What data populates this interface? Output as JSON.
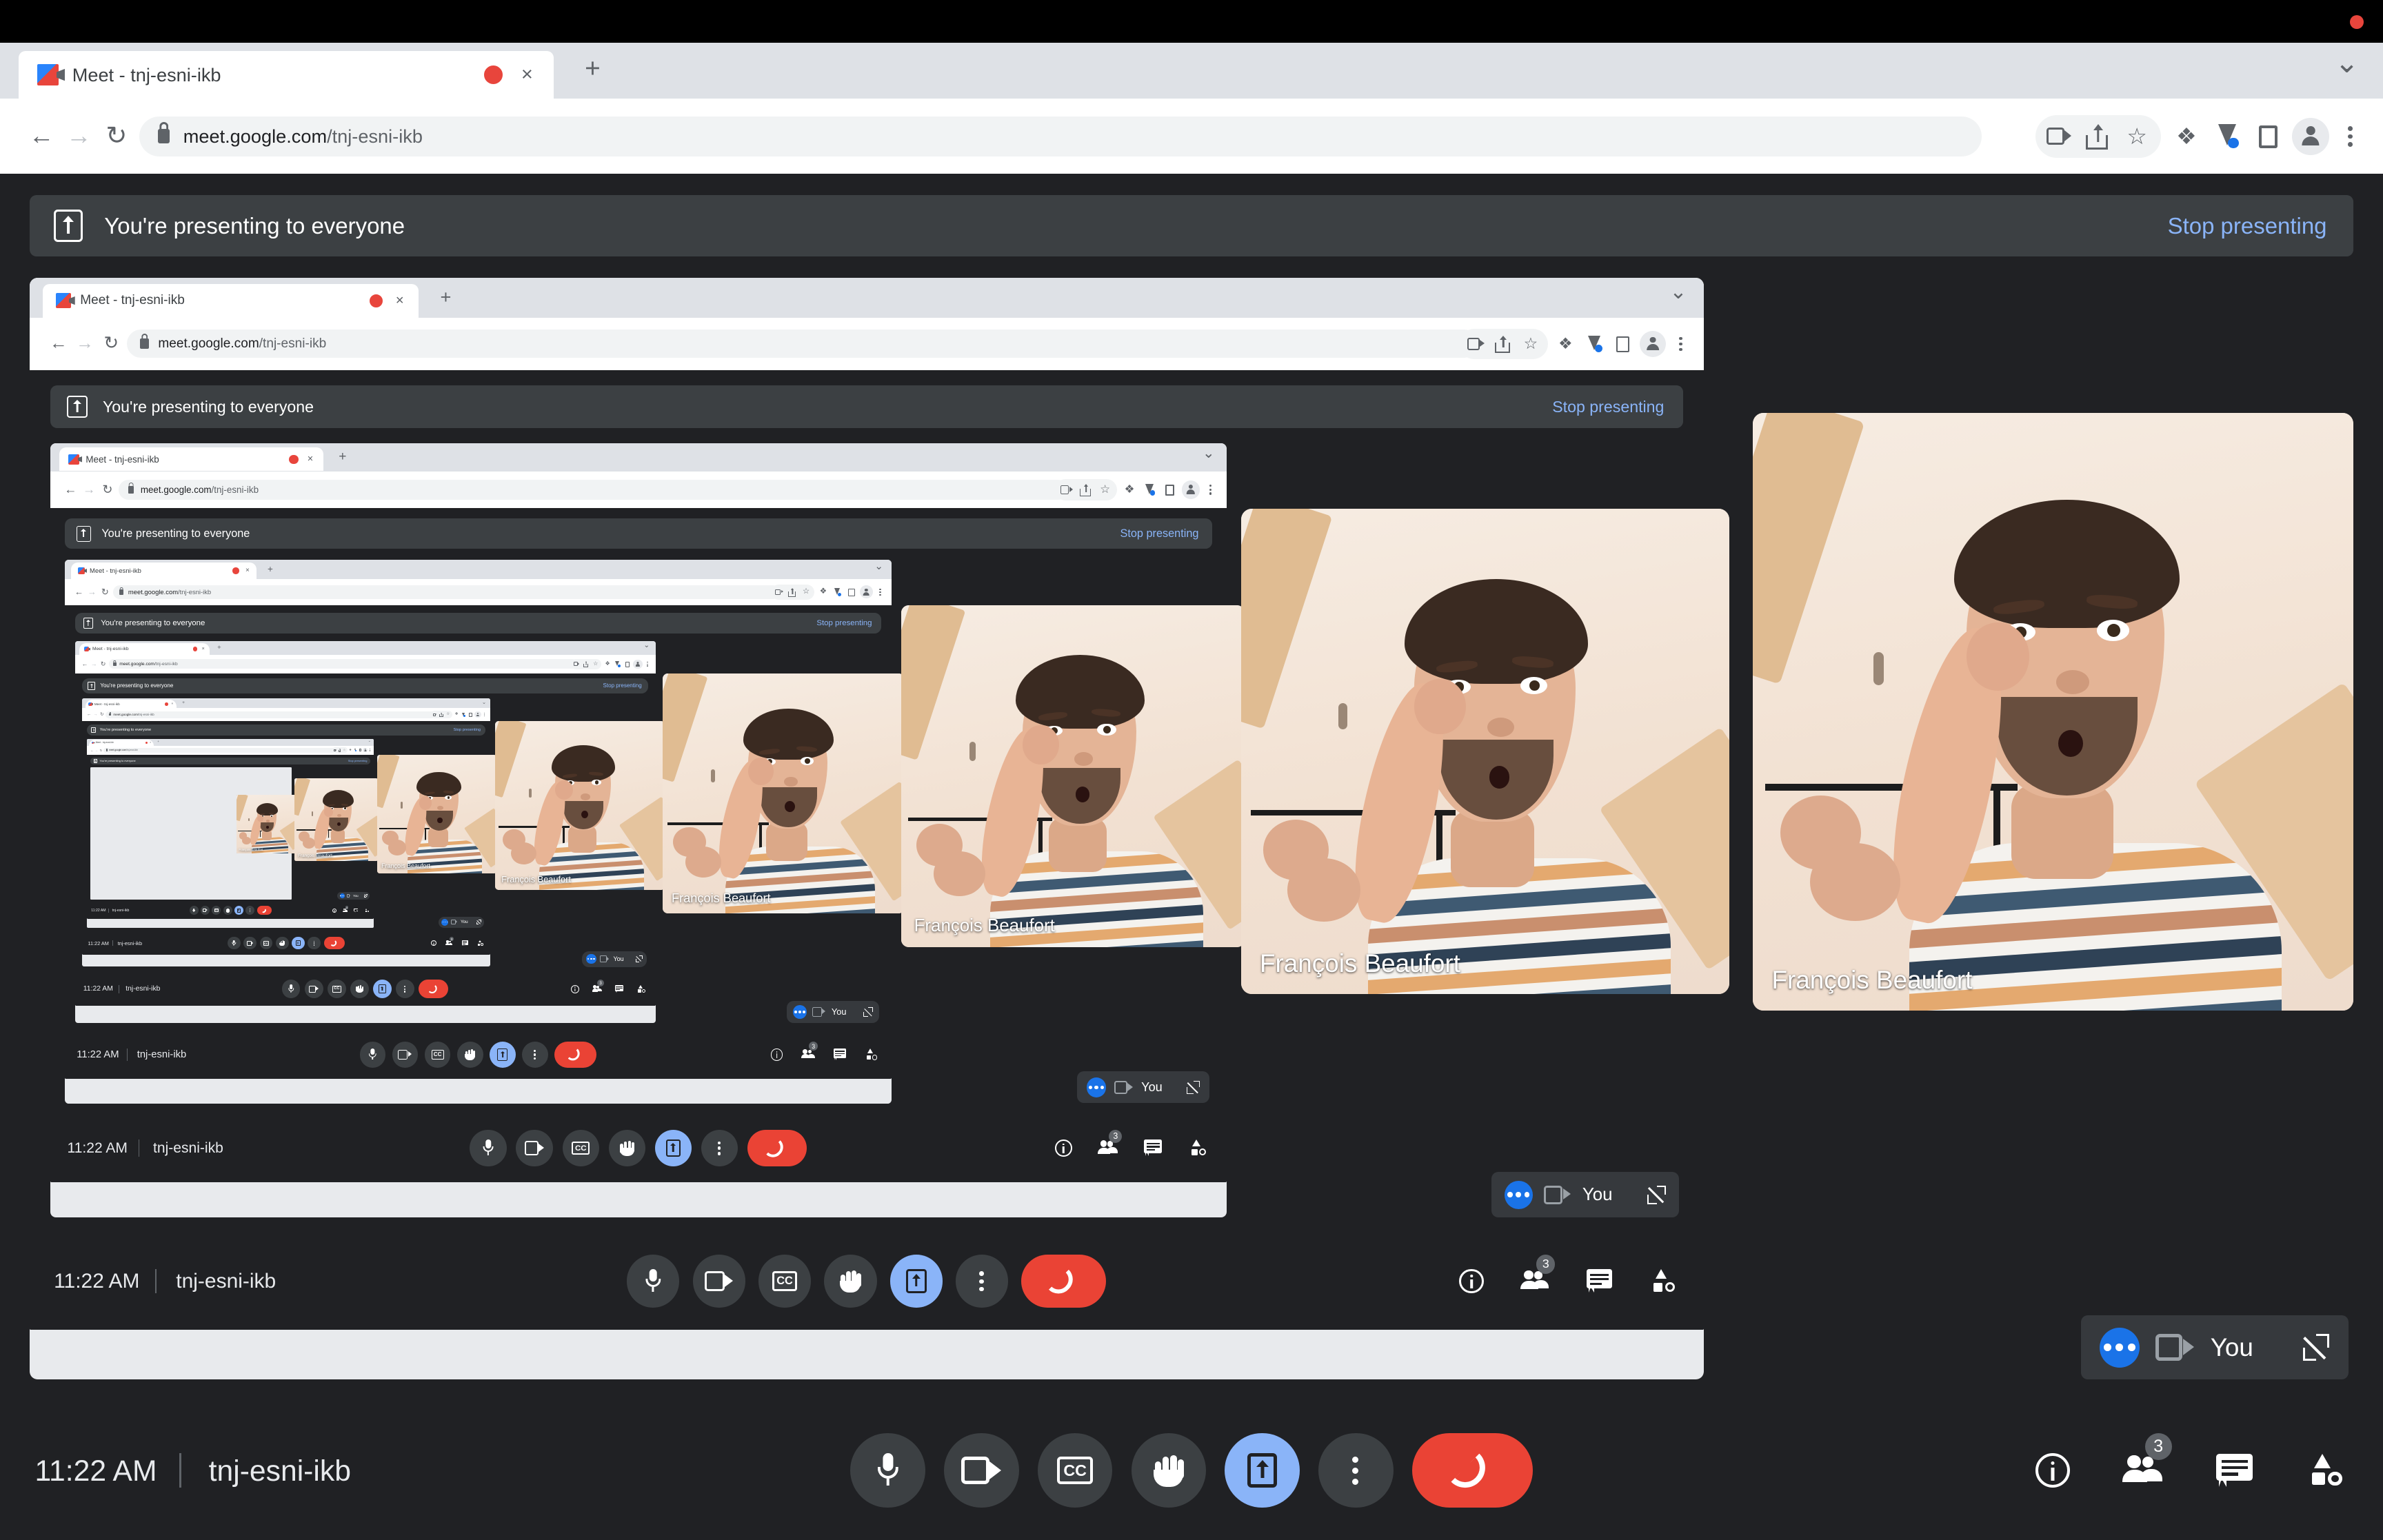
{
  "os": {
    "record_dot": "recording-indicator"
  },
  "browser": {
    "tab": {
      "title": "Meet - tnj-esni-ikb",
      "favicon": "google-meet-icon",
      "recording_icon": "tab-recording-icon",
      "close": "×"
    },
    "new_tab": "+",
    "tab_list_chevron": "⌄",
    "nav": {
      "back": "←",
      "forward": "→",
      "reload": "↻"
    },
    "url": {
      "lock": "lock-icon",
      "domain": "meet.google.com",
      "path": "/tnj-esni-ikb"
    },
    "toolbar_icons": [
      "video-camera-icon",
      "share-icon",
      "bookmark-star-icon",
      "extensions-puzzle-icon",
      "labs-beaker-icon",
      "side-panel-icon",
      "profile-avatar-icon",
      "chrome-menu-icon"
    ]
  },
  "meet": {
    "present_banner": {
      "icon": "present-screen-icon",
      "text": "You're presenting to everyone"
    },
    "stop_presenting": "Stop presenting",
    "participants": [
      {
        "name": "François Beaufort"
      },
      {
        "name": "François Beaufort"
      }
    ],
    "self_pill": {
      "status": "more-options-icon",
      "camera": "camera-off-icon",
      "label": "You",
      "expand": "expand-icon"
    },
    "footer": {
      "time": "11:22 AM",
      "meeting_code": "tnj-esni-ikb"
    },
    "controls": [
      {
        "name": "microphone-button",
        "icon": "mic-icon",
        "state": "default"
      },
      {
        "name": "camera-button",
        "icon": "camera-icon",
        "state": "default"
      },
      {
        "name": "captions-button",
        "icon": "cc-icon",
        "state": "default"
      },
      {
        "name": "raise-hand-button",
        "icon": "hand-icon",
        "state": "default"
      },
      {
        "name": "present-now-button",
        "icon": "present-screen-icon",
        "state": "active"
      },
      {
        "name": "more-options-button",
        "icon": "more-vertical-icon",
        "state": "default"
      },
      {
        "name": "leave-call-button",
        "icon": "end-call-icon",
        "state": "end"
      }
    ],
    "right_controls": [
      {
        "name": "meeting-details-button",
        "icon": "info-icon",
        "badge": ""
      },
      {
        "name": "show-everyone-button",
        "icon": "people-icon",
        "badge": "3"
      },
      {
        "name": "chat-button",
        "icon": "chat-icon",
        "badge": ""
      },
      {
        "name": "activities-button",
        "icon": "activities-icon",
        "badge": ""
      }
    ]
  },
  "colors": {
    "meet_bg": "#202124",
    "surface": "#3c4043",
    "accent_blue": "#8ab4f8",
    "link_blue": "#1a73e8",
    "danger_red": "#ea4335",
    "chrome_bg": "#dee1e6",
    "stage_bg": "#e8eaed"
  }
}
